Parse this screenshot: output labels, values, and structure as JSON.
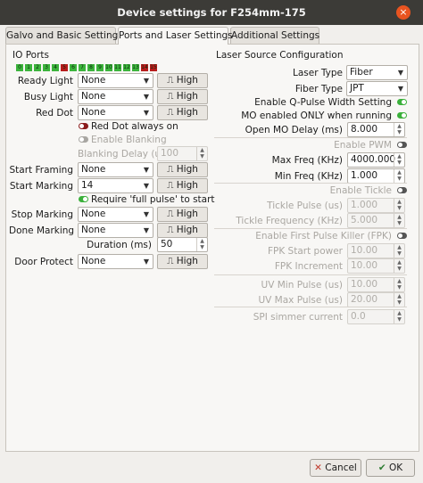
{
  "window": {
    "title": "Device settings for F254mm-175",
    "close_glyph": "×"
  },
  "tabs": [
    {
      "label": "Galvo and Basic Settings"
    },
    {
      "label": "Ports and Laser Settings"
    },
    {
      "label": "Additional Settings"
    }
  ],
  "io": {
    "heading": "IO Ports",
    "ports": [
      {
        "n": "0",
        "state": "on"
      },
      {
        "n": "1",
        "state": "on"
      },
      {
        "n": "2",
        "state": "on"
      },
      {
        "n": "3",
        "state": "on"
      },
      {
        "n": "4",
        "state": "on"
      },
      {
        "n": "5",
        "state": "off"
      },
      {
        "n": "6",
        "state": "on"
      },
      {
        "n": "7",
        "state": "on"
      },
      {
        "n": "8",
        "state": "on"
      },
      {
        "n": "9",
        "state": "on"
      },
      {
        "n": "10",
        "state": "on"
      },
      {
        "n": "11",
        "state": "on"
      },
      {
        "n": "12",
        "state": "on"
      },
      {
        "n": "13",
        "state": "on"
      },
      {
        "n": "14",
        "state": "off"
      },
      {
        "n": "15",
        "state": "off"
      }
    ],
    "on_color": "#3cb43c",
    "off_color": "#b81c1c",
    "ready_light": {
      "label": "Ready Light",
      "value": "None",
      "level": "High"
    },
    "busy_light": {
      "label": "Busy Light",
      "value": "None",
      "level": "High"
    },
    "red_dot": {
      "label": "Red Dot",
      "value": "None",
      "level": "High"
    },
    "red_dot_always_on": "Red Dot always on",
    "enable_blanking": "Enable Blanking",
    "blanking_delay": {
      "label": "Blanking Delay (us)",
      "value": "100"
    },
    "start_framing": {
      "label": "Start Framing",
      "value": "None",
      "level": "High"
    },
    "start_marking": {
      "label": "Start Marking",
      "value": "14",
      "level": "High"
    },
    "require_full_pulse": "Require 'full pulse' to start",
    "stop_marking": {
      "label": "Stop Marking",
      "value": "None",
      "level": "High"
    },
    "done_marking": {
      "label": "Done Marking",
      "value": "None",
      "level": "High"
    },
    "duration": {
      "label": "Duration (ms)",
      "value": "50"
    },
    "door_protect": {
      "label": "Door Protect",
      "value": "None",
      "level": "High"
    }
  },
  "laser": {
    "heading": "Laser Source Configuration",
    "laser_type": {
      "label": "Laser Type",
      "value": "Fiber"
    },
    "fiber_type": {
      "label": "Fiber Type",
      "value": "JPT"
    },
    "enable_qpulse": "Enable Q-Pulse Width Setting",
    "mo_enabled": "MO enabled ONLY when running",
    "open_mo_delay": {
      "label": "Open MO Delay (ms)",
      "value": "8.000"
    },
    "enable_pwm": "Enable PWM",
    "max_freq": {
      "label": "Max Freq (KHz)",
      "value": "4000.000"
    },
    "min_freq": {
      "label": "Min Freq (KHz)",
      "value": "1.000"
    },
    "enable_tickle": "Enable Tickle",
    "tickle_pulse": {
      "label": "Tickle Pulse (us)",
      "value": "1.000"
    },
    "tickle_freq": {
      "label": "Tickle Frequency (KHz)",
      "value": "5.000"
    },
    "enable_fpk": "Enable First Pulse Killer (FPK)",
    "fpk_start": {
      "label": "FPK Start power",
      "value": "10.00"
    },
    "fpk_increment": {
      "label": "FPK Increment",
      "value": "10.00"
    },
    "uv_min": {
      "label": "UV Min Pulse (us)",
      "value": "10.00"
    },
    "uv_max": {
      "label": "UV Max Pulse (us)",
      "value": "20.00"
    },
    "spi_simmer": {
      "label": "SPI simmer current",
      "value": "0.0"
    }
  },
  "footer": {
    "cancel_label": "Cancel",
    "ok_label": "OK"
  },
  "icons": {
    "pulse": "pulse-high-icon",
    "dropdown": "chevron-down-icon",
    "cancel": "cancel-icon",
    "ok": "checkmark-icon"
  }
}
